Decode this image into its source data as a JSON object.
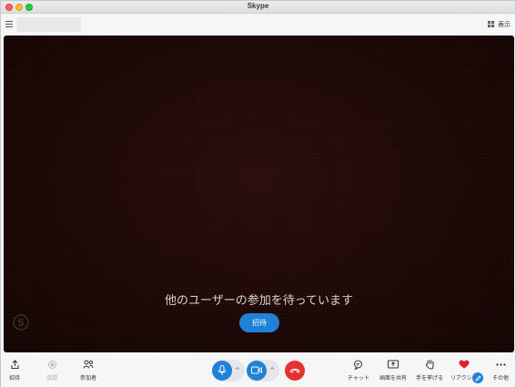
{
  "window": {
    "title": "Skype"
  },
  "topbar": {
    "view_label": "表示"
  },
  "stage": {
    "waiting_text": "他のユーザーの参加を待っています",
    "invite_button": "招待"
  },
  "toolbar": {
    "left": [
      {
        "label": "招待",
        "icon": "share-icon",
        "enabled": true
      },
      {
        "label": "収録",
        "icon": "record-icon",
        "enabled": false
      },
      {
        "label": "参加者",
        "icon": "participants-icon",
        "enabled": true
      }
    ],
    "right": [
      {
        "label": "チャット",
        "icon": "chat-icon"
      },
      {
        "label": "画面を共有",
        "icon": "share-screen-icon"
      },
      {
        "label": "手を挙げる",
        "icon": "raise-hand-icon"
      },
      {
        "label": "リアクシ...",
        "icon": "heart-icon"
      },
      {
        "label": "その他",
        "icon": "more-icon"
      }
    ]
  },
  "colors": {
    "accent": "#1f82d8",
    "end_call": "#e3322f",
    "heart": "#e0212e"
  }
}
